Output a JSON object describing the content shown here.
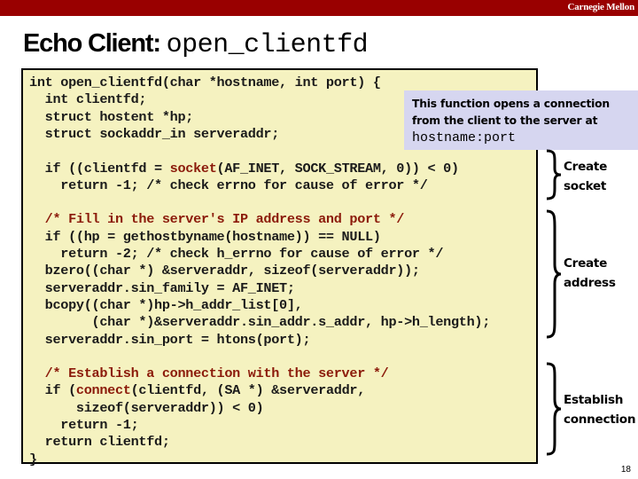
{
  "header": {
    "brand": "Carnegie Mellon",
    "bar_color": "#990000"
  },
  "title": {
    "prefix": "Echo Client: ",
    "code": "open_clientfd"
  },
  "code": {
    "lines": [
      {
        "segments": [
          {
            "text": "int open_clientfd(char *hostname, int port) {",
            "style": "plain"
          }
        ]
      },
      {
        "segments": [
          {
            "text": "  int clientfd;",
            "style": "plain"
          }
        ]
      },
      {
        "segments": [
          {
            "text": "  struct hostent *hp;",
            "style": "plain"
          }
        ]
      },
      {
        "segments": [
          {
            "text": "  struct sockaddr_in serveraddr;",
            "style": "plain"
          }
        ]
      },
      {
        "segments": [
          {
            "text": "",
            "style": "plain"
          }
        ]
      },
      {
        "segments": [
          {
            "text": "  if ((clientfd = ",
            "style": "plain"
          },
          {
            "text": "socket",
            "style": "func"
          },
          {
            "text": "(AF_INET, SOCK_STREAM, 0)) < 0)",
            "style": "plain"
          }
        ]
      },
      {
        "segments": [
          {
            "text": "    return -1; /* check errno for cause of error */",
            "style": "plain"
          }
        ]
      },
      {
        "segments": [
          {
            "text": "",
            "style": "plain"
          }
        ]
      },
      {
        "segments": [
          {
            "text": "  /* Fill in the server's IP address and port */",
            "style": "comment"
          }
        ]
      },
      {
        "segments": [
          {
            "text": "  if ((hp = gethostbyname(hostname)) == NULL)",
            "style": "plain"
          }
        ]
      },
      {
        "segments": [
          {
            "text": "    return -2; /* check h_errno for cause of error */",
            "style": "plain"
          }
        ]
      },
      {
        "segments": [
          {
            "text": "  bzero((char *) &serveraddr, sizeof(serveraddr));",
            "style": "plain"
          }
        ]
      },
      {
        "segments": [
          {
            "text": "  serveraddr.sin_family = AF_INET;",
            "style": "plain"
          }
        ]
      },
      {
        "segments": [
          {
            "text": "  bcopy((char *)hp->h_addr_list[0],",
            "style": "plain"
          }
        ]
      },
      {
        "segments": [
          {
            "text": "        (char *)&serveraddr.sin_addr.s_addr, hp->h_length);",
            "style": "plain"
          }
        ]
      },
      {
        "segments": [
          {
            "text": "  serveraddr.sin_port = htons(port);",
            "style": "plain"
          }
        ]
      },
      {
        "segments": [
          {
            "text": "",
            "style": "plain"
          }
        ]
      },
      {
        "segments": [
          {
            "text": "  /* Establish a connection with the server */",
            "style": "comment"
          }
        ]
      },
      {
        "segments": [
          {
            "text": "  if (",
            "style": "plain"
          },
          {
            "text": "connect",
            "style": "func"
          },
          {
            "text": "(clientfd, (SA *) &serveraddr,",
            "style": "plain"
          }
        ]
      },
      {
        "segments": [
          {
            "text": "      sizeof(serveraddr)) < 0)",
            "style": "plain"
          }
        ]
      },
      {
        "segments": [
          {
            "text": "    return -1;",
            "style": "plain"
          }
        ]
      },
      {
        "segments": [
          {
            "text": "  return clientfd;",
            "style": "plain"
          }
        ]
      },
      {
        "segments": [
          {
            "text": "}",
            "style": "plain"
          }
        ]
      }
    ],
    "background": "#f5f2c0",
    "highlight_color": "#8b1a0a"
  },
  "callout": {
    "line1": "This function opens a connection",
    "line2": "from the client to the server at",
    "line3": "hostname:port",
    "background": "#d6d6f0"
  },
  "annotations": [
    {
      "line1": "Create",
      "line2": "socket"
    },
    {
      "line1": "Create",
      "line2": "address"
    },
    {
      "line1": "Establish",
      "line2": "connection"
    }
  ],
  "page_number": "18"
}
